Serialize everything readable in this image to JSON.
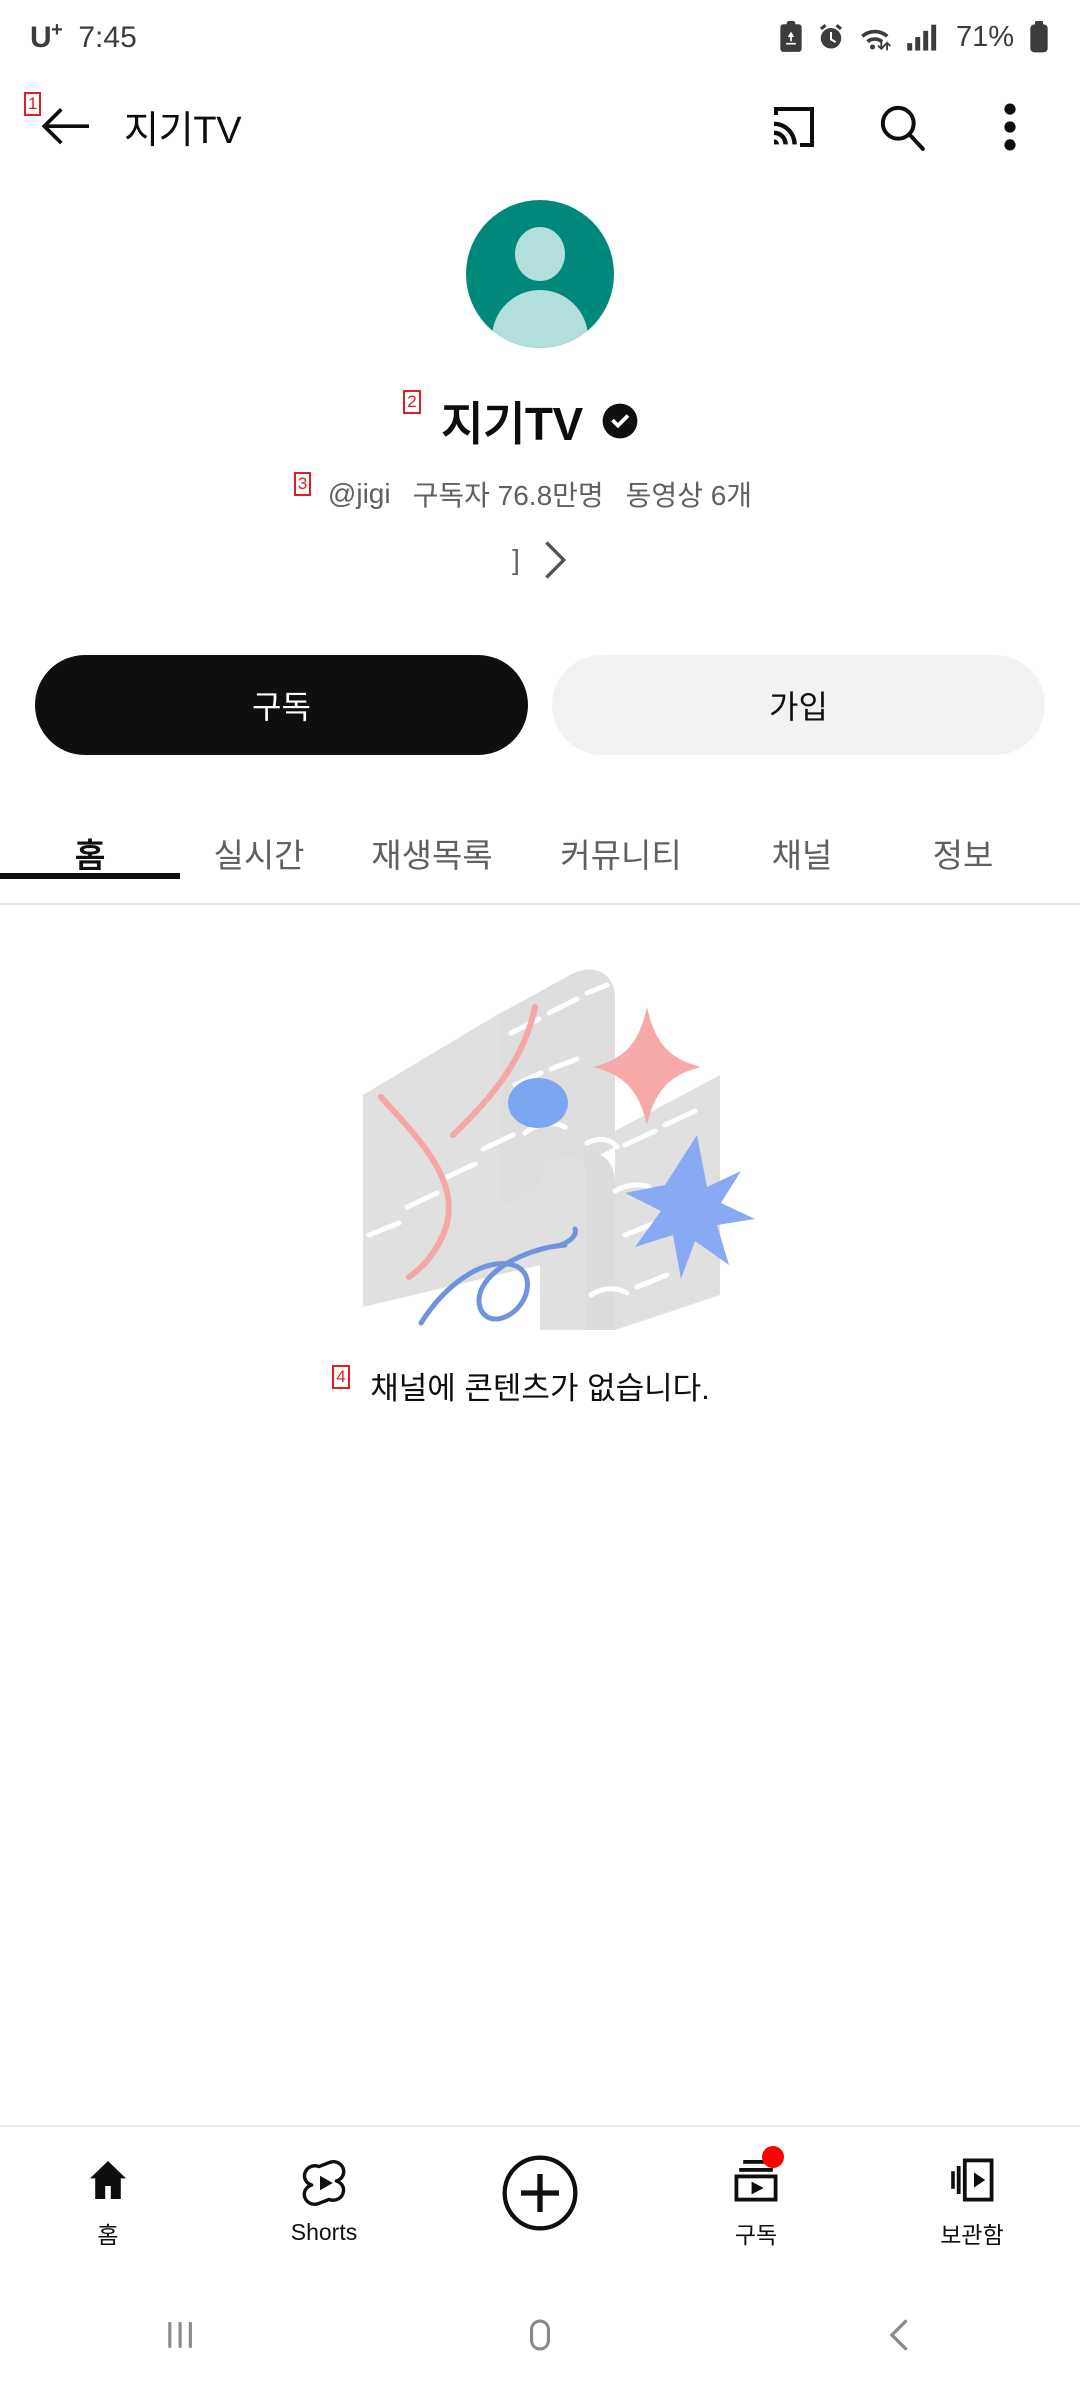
{
  "status_bar": {
    "carrier": "U",
    "carrier_sup": "+",
    "time": "7:45",
    "battery_percent": "71%",
    "icons": [
      "clipboard-recycle-icon",
      "alarm-clock-icon",
      "wifi-icon",
      "signal-bars-icon",
      "battery-icon"
    ]
  },
  "app_bar": {
    "back_icon": "arrow-left-icon",
    "title": "지기TV",
    "cast_icon": "cast-icon",
    "search_icon": "search-icon",
    "overflow_icon": "more-vertical-icon"
  },
  "annotations": [
    {
      "id": "1",
      "target": "back-button"
    },
    {
      "id": "2",
      "target": "channel-name"
    },
    {
      "id": "3",
      "target": "channel-handle"
    },
    {
      "id": "4",
      "target": "empty-state-text"
    }
  ],
  "channel": {
    "avatar_color": "#00897b",
    "avatar_figure_color": "#b2dfdb",
    "name": "지기TV",
    "verified": true,
    "handle": "@jigi",
    "subscribers": "구독자 76.8만명",
    "video_count": "동영상 6개",
    "description_snippet": "]",
    "description_chevron": "chevron-right-icon"
  },
  "actions": {
    "subscribe_label": "구독",
    "join_label": "가입"
  },
  "tabs": [
    {
      "label": "홈",
      "active": true
    },
    {
      "label": "실시간",
      "active": false
    },
    {
      "label": "재생목록",
      "active": false
    },
    {
      "label": "커뮤니티",
      "active": false
    },
    {
      "label": "채널",
      "active": false
    },
    {
      "label": "정보",
      "active": false
    }
  ],
  "empty_state": {
    "illustration": "winding-road-illustration",
    "message": "채널에 콘텐츠가 없습니다."
  },
  "bottom_nav": [
    {
      "label": "홈",
      "icon": "home-icon",
      "active": true,
      "badge": false
    },
    {
      "label": "Shorts",
      "icon": "shorts-icon",
      "active": false,
      "badge": false
    },
    {
      "label": "",
      "icon": "plus-circle-icon",
      "active": false,
      "badge": false
    },
    {
      "label": "구독",
      "icon": "subscriptions-icon",
      "active": false,
      "badge": true
    },
    {
      "label": "보관함",
      "icon": "library-icon",
      "active": false,
      "badge": false
    }
  ],
  "system_nav": {
    "recents_icon": "recents-icon",
    "home_icon": "home-pill-icon",
    "back_icon": "back-chevron-icon"
  },
  "colors": {
    "accent_red": "#ff0000",
    "text_primary": "#0f0f0f",
    "text_secondary": "#606060",
    "marker_red": "#e02020"
  }
}
